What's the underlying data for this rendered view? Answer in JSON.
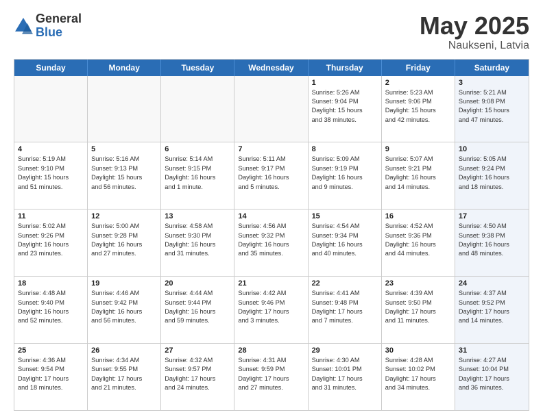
{
  "logo": {
    "general": "General",
    "blue": "Blue"
  },
  "title": {
    "month": "May 2025",
    "location": "Naukseni, Latvia"
  },
  "header": {
    "days": [
      "Sunday",
      "Monday",
      "Tuesday",
      "Wednesday",
      "Thursday",
      "Friday",
      "Saturday"
    ]
  },
  "rows": [
    [
      {
        "day": "",
        "info": ""
      },
      {
        "day": "",
        "info": ""
      },
      {
        "day": "",
        "info": ""
      },
      {
        "day": "",
        "info": ""
      },
      {
        "day": "1",
        "info": "Sunrise: 5:26 AM\nSunset: 9:04 PM\nDaylight: 15 hours\nand 38 minutes."
      },
      {
        "day": "2",
        "info": "Sunrise: 5:23 AM\nSunset: 9:06 PM\nDaylight: 15 hours\nand 42 minutes."
      },
      {
        "day": "3",
        "info": "Sunrise: 5:21 AM\nSunset: 9:08 PM\nDaylight: 15 hours\nand 47 minutes."
      }
    ],
    [
      {
        "day": "4",
        "info": "Sunrise: 5:19 AM\nSunset: 9:10 PM\nDaylight: 15 hours\nand 51 minutes."
      },
      {
        "day": "5",
        "info": "Sunrise: 5:16 AM\nSunset: 9:13 PM\nDaylight: 15 hours\nand 56 minutes."
      },
      {
        "day": "6",
        "info": "Sunrise: 5:14 AM\nSunset: 9:15 PM\nDaylight: 16 hours\nand 1 minute."
      },
      {
        "day": "7",
        "info": "Sunrise: 5:11 AM\nSunset: 9:17 PM\nDaylight: 16 hours\nand 5 minutes."
      },
      {
        "day": "8",
        "info": "Sunrise: 5:09 AM\nSunset: 9:19 PM\nDaylight: 16 hours\nand 9 minutes."
      },
      {
        "day": "9",
        "info": "Sunrise: 5:07 AM\nSunset: 9:21 PM\nDaylight: 16 hours\nand 14 minutes."
      },
      {
        "day": "10",
        "info": "Sunrise: 5:05 AM\nSunset: 9:24 PM\nDaylight: 16 hours\nand 18 minutes."
      }
    ],
    [
      {
        "day": "11",
        "info": "Sunrise: 5:02 AM\nSunset: 9:26 PM\nDaylight: 16 hours\nand 23 minutes."
      },
      {
        "day": "12",
        "info": "Sunrise: 5:00 AM\nSunset: 9:28 PM\nDaylight: 16 hours\nand 27 minutes."
      },
      {
        "day": "13",
        "info": "Sunrise: 4:58 AM\nSunset: 9:30 PM\nDaylight: 16 hours\nand 31 minutes."
      },
      {
        "day": "14",
        "info": "Sunrise: 4:56 AM\nSunset: 9:32 PM\nDaylight: 16 hours\nand 35 minutes."
      },
      {
        "day": "15",
        "info": "Sunrise: 4:54 AM\nSunset: 9:34 PM\nDaylight: 16 hours\nand 40 minutes."
      },
      {
        "day": "16",
        "info": "Sunrise: 4:52 AM\nSunset: 9:36 PM\nDaylight: 16 hours\nand 44 minutes."
      },
      {
        "day": "17",
        "info": "Sunrise: 4:50 AM\nSunset: 9:38 PM\nDaylight: 16 hours\nand 48 minutes."
      }
    ],
    [
      {
        "day": "18",
        "info": "Sunrise: 4:48 AM\nSunset: 9:40 PM\nDaylight: 16 hours\nand 52 minutes."
      },
      {
        "day": "19",
        "info": "Sunrise: 4:46 AM\nSunset: 9:42 PM\nDaylight: 16 hours\nand 56 minutes."
      },
      {
        "day": "20",
        "info": "Sunrise: 4:44 AM\nSunset: 9:44 PM\nDaylight: 16 hours\nand 59 minutes."
      },
      {
        "day": "21",
        "info": "Sunrise: 4:42 AM\nSunset: 9:46 PM\nDaylight: 17 hours\nand 3 minutes."
      },
      {
        "day": "22",
        "info": "Sunrise: 4:41 AM\nSunset: 9:48 PM\nDaylight: 17 hours\nand 7 minutes."
      },
      {
        "day": "23",
        "info": "Sunrise: 4:39 AM\nSunset: 9:50 PM\nDaylight: 17 hours\nand 11 minutes."
      },
      {
        "day": "24",
        "info": "Sunrise: 4:37 AM\nSunset: 9:52 PM\nDaylight: 17 hours\nand 14 minutes."
      }
    ],
    [
      {
        "day": "25",
        "info": "Sunrise: 4:36 AM\nSunset: 9:54 PM\nDaylight: 17 hours\nand 18 minutes."
      },
      {
        "day": "26",
        "info": "Sunrise: 4:34 AM\nSunset: 9:55 PM\nDaylight: 17 hours\nand 21 minutes."
      },
      {
        "day": "27",
        "info": "Sunrise: 4:32 AM\nSunset: 9:57 PM\nDaylight: 17 hours\nand 24 minutes."
      },
      {
        "day": "28",
        "info": "Sunrise: 4:31 AM\nSunset: 9:59 PM\nDaylight: 17 hours\nand 27 minutes."
      },
      {
        "day": "29",
        "info": "Sunrise: 4:30 AM\nSunset: 10:01 PM\nDaylight: 17 hours\nand 31 minutes."
      },
      {
        "day": "30",
        "info": "Sunrise: 4:28 AM\nSunset: 10:02 PM\nDaylight: 17 hours\nand 34 minutes."
      },
      {
        "day": "31",
        "info": "Sunrise: 4:27 AM\nSunset: 10:04 PM\nDaylight: 17 hours\nand 36 minutes."
      }
    ]
  ]
}
